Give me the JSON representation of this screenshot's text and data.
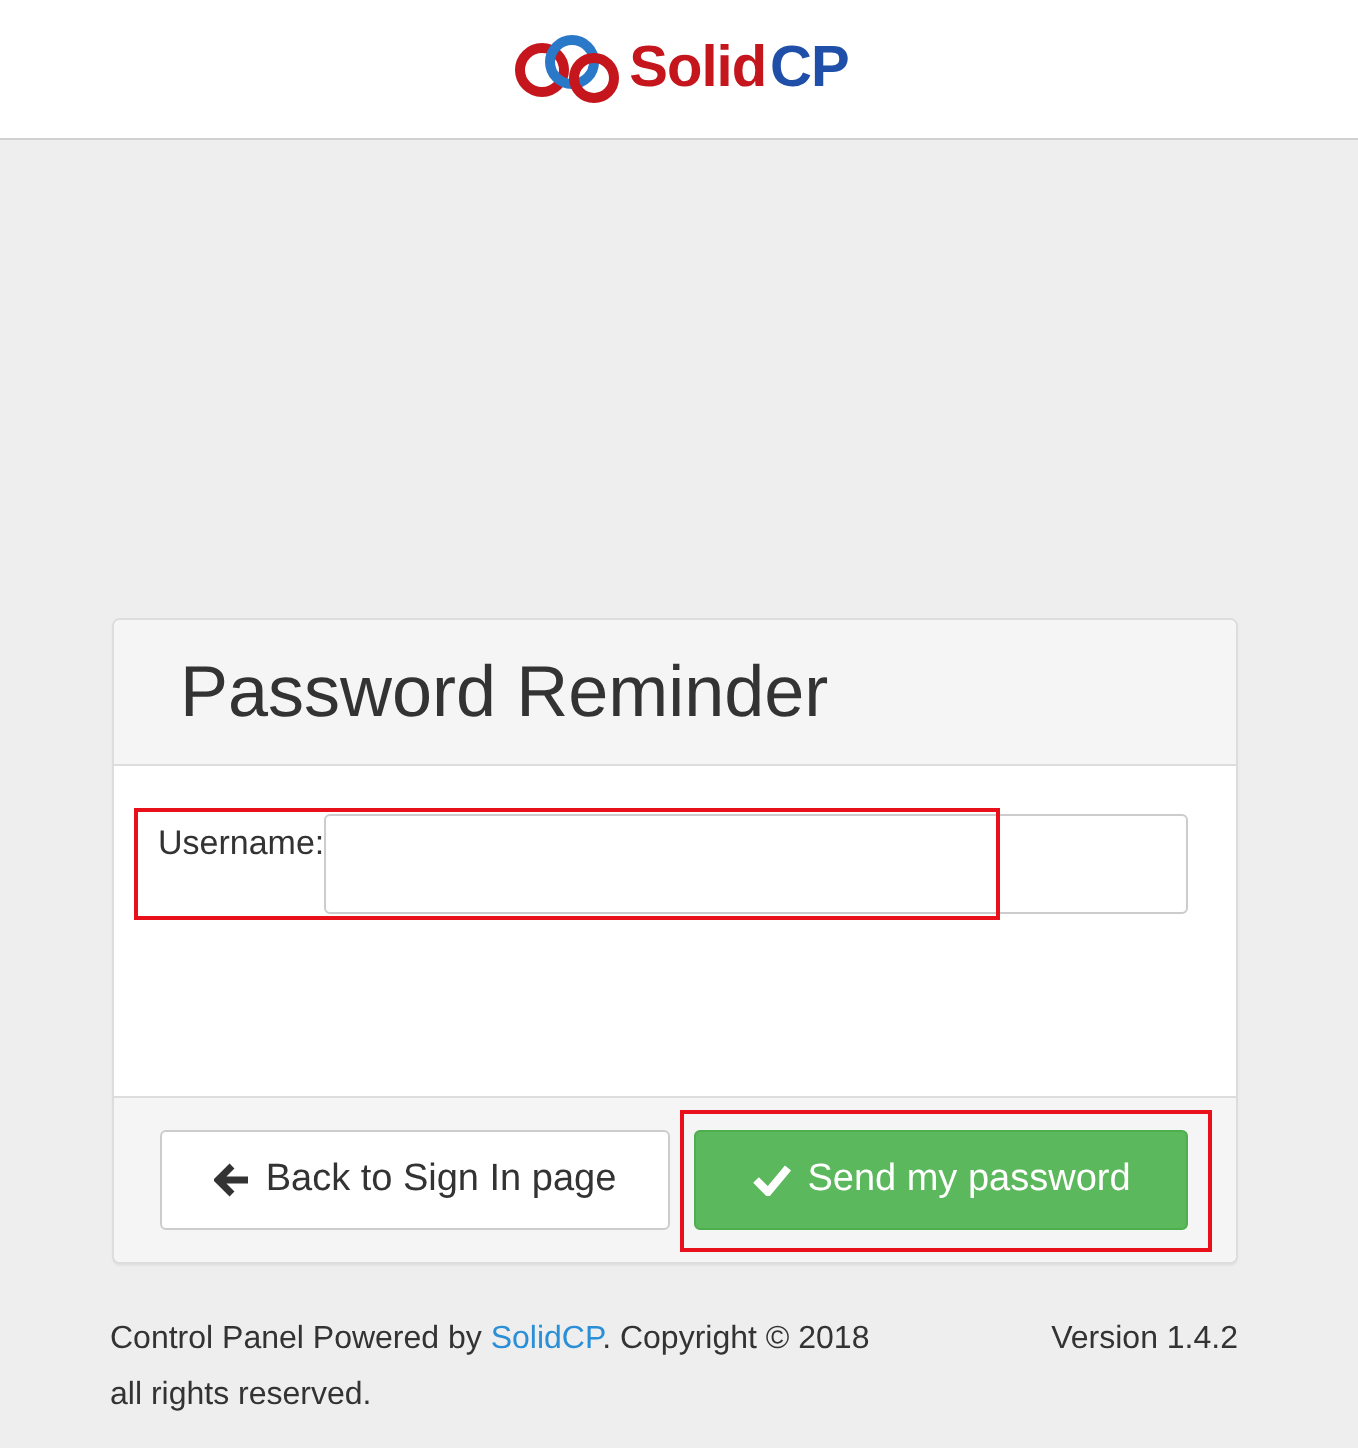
{
  "logo": {
    "parts": [
      {
        "text": "Solid",
        "color": "#c4161c"
      },
      {
        "text": "CP",
        "color": "#1f4fa8"
      }
    ]
  },
  "panel": {
    "title": "Password Reminder",
    "username": {
      "label": "Username:",
      "highlighted": true
    },
    "buttons": [
      {
        "kind": "back",
        "label": "Back to Sign In page",
        "highlighted": false
      },
      {
        "kind": "send",
        "label": "Send my password",
        "highlighted": true
      }
    ]
  },
  "footer": {
    "before": "Control Panel Powered by ",
    "link": "SolidCP",
    "after": ". Copyright © 2018 all rights reserved.",
    "version": "Version 1.4.2"
  }
}
